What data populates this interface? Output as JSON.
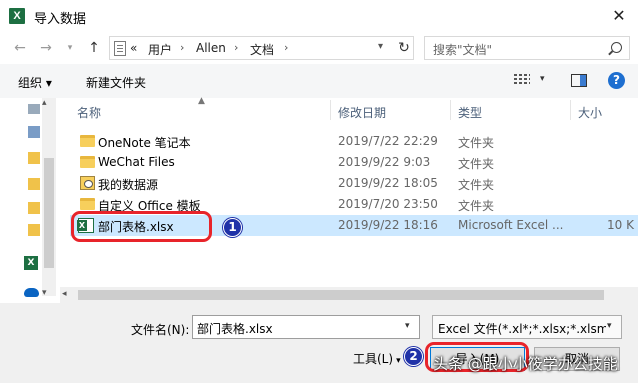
{
  "window": {
    "title": "导入数据",
    "app_icon": "X"
  },
  "nav": {
    "breadcrumb": [
      "«",
      "用户",
      "Allen",
      "文档"
    ],
    "search_placeholder": "搜索\"文档\""
  },
  "toolbar": {
    "organize": "组织 ▾",
    "new_folder": "新建文件夹",
    "help": "?"
  },
  "columns": {
    "name": "名称",
    "date": "修改日期",
    "type": "类型",
    "size": "大小"
  },
  "files": [
    {
      "name": "OneNote 笔记本",
      "date": "2019/7/22 22:29",
      "type": "文件夹",
      "size": "",
      "icon": "folder-icon"
    },
    {
      "name": "WeChat Files",
      "date": "2019/9/22 9:03",
      "type": "文件夹",
      "size": "",
      "icon": "folder-icon"
    },
    {
      "name": "我的数据源",
      "date": "2019/9/22 18:05",
      "type": "文件夹",
      "size": "",
      "icon": "data-source-icon"
    },
    {
      "name": "自定义 Office 模板",
      "date": "2019/7/20 23:50",
      "type": "文件夹",
      "size": "",
      "icon": "folder-icon"
    },
    {
      "name": "部门表格.xlsx",
      "date": "2019/9/22 18:16",
      "type": "Microsoft Excel ...",
      "size": "10 K",
      "icon": "excel-file-icon",
      "selected": true
    }
  ],
  "markers": {
    "one": "1",
    "two": "2"
  },
  "footer": {
    "filename_label": "文件名(N):",
    "filename_value": "部门表格.xlsx",
    "filetype_value": "Excel 文件(*.xl*;*.xlsx;*.xlsm;*.",
    "tools_label": "工具(L)",
    "import_button": "导入(M)",
    "cancel_button": "取消"
  },
  "watermark": "头条 @跟小小筱学办公技能",
  "colors": {
    "selection": "#cce8ff",
    "annotation_red": "#e8242a",
    "marker_blue": "#2032a8",
    "excel_green": "#1d6f42"
  }
}
